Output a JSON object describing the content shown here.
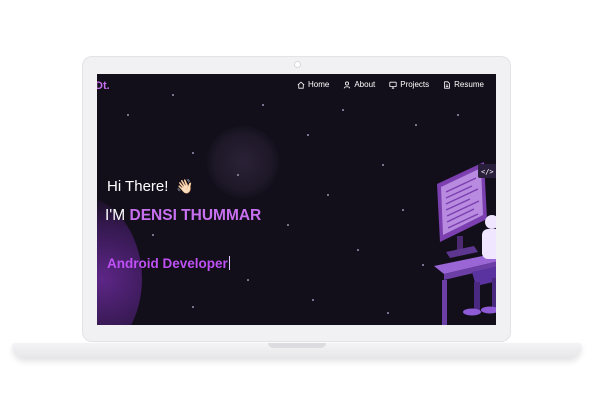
{
  "header": {
    "logo": "Dt.",
    "nav": [
      {
        "label": "Home",
        "icon": "home-icon"
      },
      {
        "label": "About",
        "icon": "user-icon"
      },
      {
        "label": "Projects",
        "icon": "projects-icon"
      },
      {
        "label": "Resume",
        "icon": "document-icon"
      }
    ]
  },
  "hero": {
    "greeting": "Hi There!",
    "greeting_emoji": "👋🏻",
    "intro_prefix": "I'M",
    "name": "DENSI THUMMAR",
    "role": "Android Developer"
  },
  "colors": {
    "accent": "#c770f0",
    "role": "#be50f4",
    "background": "#130f1a"
  }
}
